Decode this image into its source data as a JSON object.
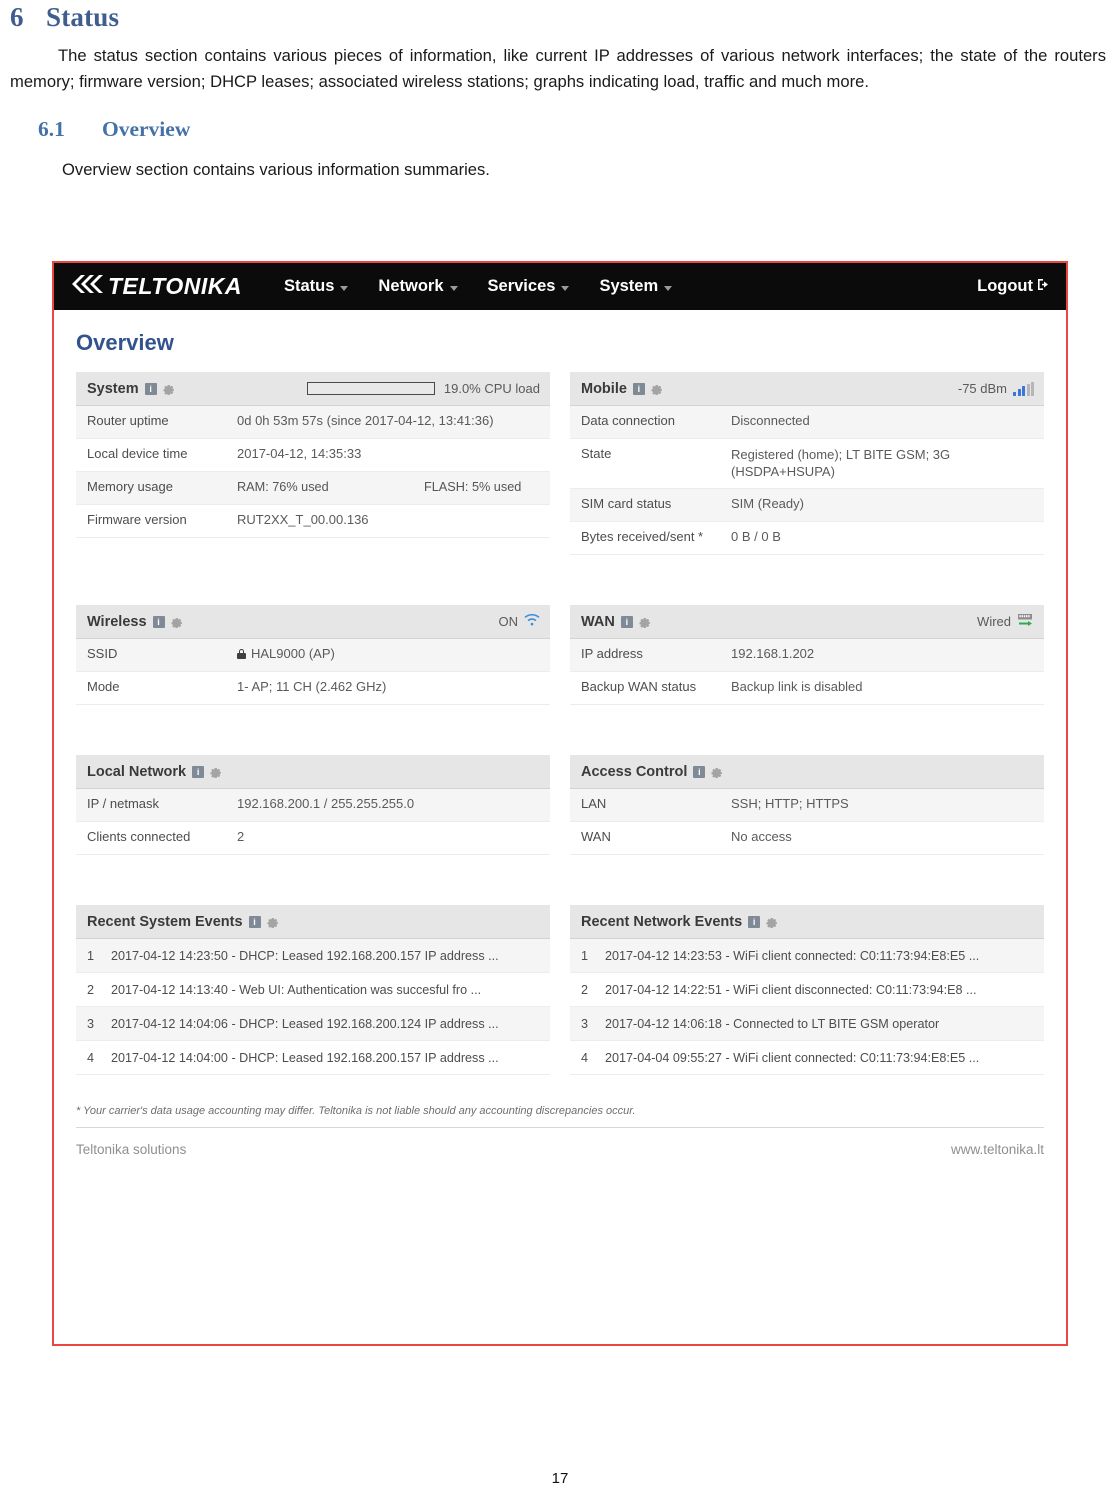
{
  "document": {
    "chapter_number": "6",
    "chapter_title": "Status",
    "intro_paragraph": "The status section contains various pieces of information, like current IP addresses of various network interfaces; the state of the routers memory; firmware version; DHCP leases; associated wireless stations; graphs indicating load, traffic and much more.",
    "section_number": "6.1",
    "section_title": "Overview",
    "section_paragraph": "Overview section contains various information summaries.",
    "page_number": "17"
  },
  "router_ui": {
    "brand": "TELTONIKA",
    "nav": [
      {
        "label": "Status"
      },
      {
        "label": "Network"
      },
      {
        "label": "Services"
      },
      {
        "label": "System"
      }
    ],
    "logout_label": "Logout",
    "page_title": "Overview",
    "cards": {
      "system": {
        "title": "System",
        "status_text": "19.0% CPU load",
        "cpu_percent": 19.0,
        "rows": [
          {
            "key": "Router uptime",
            "value": "0d 0h 53m 57s (since 2017-04-12, 13:41:36)"
          },
          {
            "key": "Local device time",
            "value": "2017-04-12, 14:35:33"
          },
          {
            "key": "Memory usage",
            "value": ""
          },
          {
            "key": "Firmware version",
            "value": "RUT2XX_T_00.00.136"
          }
        ],
        "memory": {
          "ram_label": "RAM: 76% used",
          "ram_percent": 76,
          "flash_label": "FLASH: 5% used",
          "flash_percent": 5
        }
      },
      "mobile": {
        "title": "Mobile",
        "status_text": "-75 dBm",
        "signal_bars_filled": 3,
        "signal_bars_total": 5,
        "rows": [
          {
            "key": "Data connection",
            "value": "Disconnected"
          },
          {
            "key": "State",
            "value": "Registered (home); LT BITE GSM; 3G (HSDPA+HSUPA)"
          },
          {
            "key": "SIM card status",
            "value": "SIM (Ready)"
          },
          {
            "key": "Bytes received/sent *",
            "value": "0 B / 0 B"
          }
        ]
      },
      "wireless": {
        "title": "Wireless",
        "status_text": "ON",
        "rows": [
          {
            "key": "SSID",
            "value": "HAL9000 (AP)",
            "locked": true
          },
          {
            "key": "Mode",
            "value": "1- AP; 11 CH (2.462 GHz)"
          }
        ]
      },
      "wan": {
        "title": "WAN",
        "status_text": "Wired",
        "rows": [
          {
            "key": "IP address",
            "value": "192.168.1.202"
          },
          {
            "key": "Backup WAN status",
            "value": "Backup link is disabled"
          }
        ]
      },
      "local_network": {
        "title": "Local Network",
        "status_text": "",
        "rows": [
          {
            "key": "IP / netmask",
            "value": "192.168.200.1 / 255.255.255.0"
          },
          {
            "key": "Clients connected",
            "value": "2"
          }
        ]
      },
      "access_control": {
        "title": "Access Control",
        "status_text": "",
        "rows": [
          {
            "key": "LAN",
            "value": "SSH; HTTP; HTTPS"
          },
          {
            "key": "WAN",
            "value": "No access"
          }
        ]
      },
      "recent_system_events": {
        "title": "Recent System Events",
        "events": [
          {
            "index": "1",
            "text": "2017-04-12 14:23:50 - DHCP: Leased 192.168.200.157 IP address ..."
          },
          {
            "index": "2",
            "text": "2017-04-12 14:13:40 - Web UI: Authentication was succesful fro ..."
          },
          {
            "index": "3",
            "text": "2017-04-12 14:04:06 - DHCP: Leased 192.168.200.124 IP address ..."
          },
          {
            "index": "4",
            "text": "2017-04-12 14:04:00 - DHCP: Leased 192.168.200.157 IP address ..."
          }
        ]
      },
      "recent_network_events": {
        "title": "Recent Network Events",
        "events": [
          {
            "index": "1",
            "text": "2017-04-12 14:23:53 - WiFi client connected: C0:11:73:94:E8:E5 ..."
          },
          {
            "index": "2",
            "text": "2017-04-12 14:22:51 - WiFi client disconnected: C0:11:73:94:E8 ..."
          },
          {
            "index": "3",
            "text": "2017-04-12 14:06:18 - Connected to LT BITE GSM operator"
          },
          {
            "index": "4",
            "text": "2017-04-04 09:55:27 - WiFi client connected: C0:11:73:94:E8:E5 ..."
          }
        ]
      }
    },
    "disclaimer": "* Your carrier's data usage accounting may differ. Teltonika is not liable should any accounting discrepancies occur.",
    "footer_left": "Teltonika solutions",
    "footer_right": "www.teltonika.lt"
  },
  "colors": {
    "heading": "#3f5d8f",
    "subheading": "#4472a8",
    "frame_border": "#e8483f",
    "navbar_bg": "#0b0b0b",
    "accent_blue": "#3a76d8",
    "card_head_bg": "#e6e6e6"
  }
}
